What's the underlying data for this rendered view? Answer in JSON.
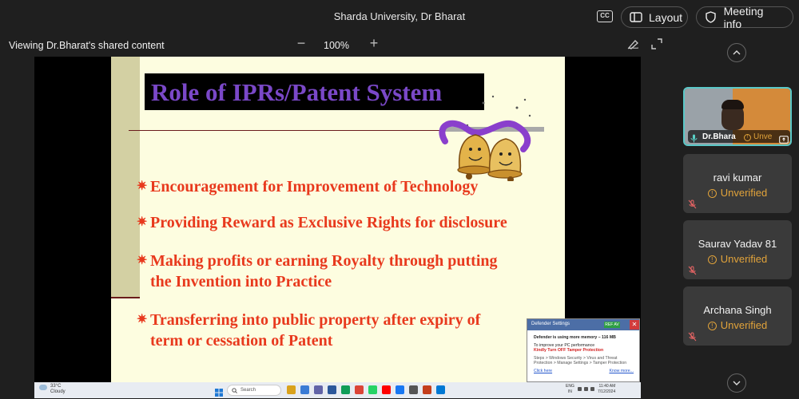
{
  "header": {
    "meeting_title": "Sharda University, Dr Bharat",
    "cc_label": "CC",
    "layout_label": "Layout",
    "meeting_info_label": "Meeting info"
  },
  "share_bar": {
    "viewing_label": "Viewing Dr.Bharat's shared content",
    "zoom_minus": "−",
    "zoom_level": "100%",
    "zoom_plus": "+"
  },
  "slide": {
    "title": "Role of IPRs/Patent System",
    "bullet_symbol": "✷",
    "bullets": [
      "Encouragement for Improvement of Technology",
      "Providing Reward as Exclusive Rights for disclosure",
      [
        "Making profits or earning Royalty through putting",
        "the Invention into Practice"
      ],
      [
        "Transferring into public property after expiry of",
        "term  or cessation of Patent"
      ]
    ],
    "colors": {
      "title": "#7a48c8",
      "bullets": "#e8391d",
      "background": "#fdfde0"
    }
  },
  "taskbar": {
    "weather_temp": "33°C",
    "weather_desc": "Cloudy",
    "search_placeholder": "Search",
    "lang_line1": "ENG",
    "lang_line2": "IN",
    "time": "11:40 AM",
    "date": "7/12/2024"
  },
  "defender": {
    "title": "Defender Settings",
    "badge": "REF AV",
    "close": "✕",
    "line1": "Defender is using more memory –  116 MB",
    "line2": "To improve your PC performance",
    "line3": "Kindly Turn OFF Tamper Protection",
    "line4": "Steps > Windows Security > Virus and Threat",
    "line5": "Protection > Manage Settings > Tamper Protection",
    "link_left": "Click here",
    "link_right": "Know more..."
  },
  "participants": [
    {
      "name": "Dr.Bhara",
      "status": "Unve",
      "video": true
    },
    {
      "name": "ravi kumar",
      "status": "Unverified",
      "video": false
    },
    {
      "name": "Saurav Yadav 81",
      "status": "Unverified",
      "video": false
    },
    {
      "name": "Archana Singh",
      "status": "Unverified",
      "video": false
    }
  ],
  "icons": {
    "layout": "layout-icon",
    "meeting_info": "shield-icon",
    "warning": "!",
    "colors": {
      "accent_border": "#5ac8c8",
      "unverified": "#e1a33a"
    }
  }
}
